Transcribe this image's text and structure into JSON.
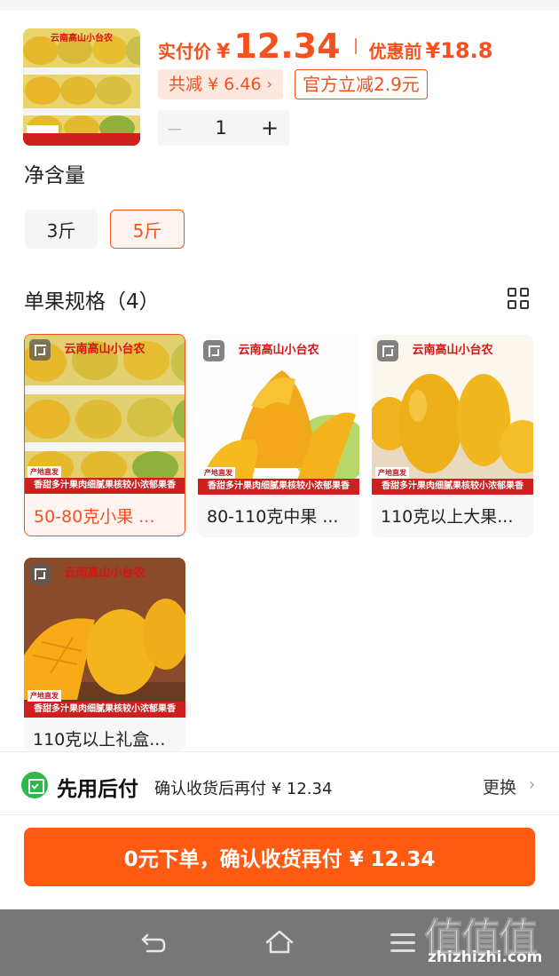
{
  "product": {
    "price_label": "实付价",
    "price_currency": "¥",
    "price_value": "12.34",
    "price_before_label": "优惠前",
    "price_before": "¥18.8",
    "discount_total": "共减 ¥ 6.46",
    "official_discount": "官方立减2.9元",
    "quantity": "1",
    "minus_label": "－",
    "plus_label": "+"
  },
  "net_content": {
    "title": "净含量",
    "options": [
      {
        "label": "3斤",
        "selected": false
      },
      {
        "label": "5斤",
        "selected": true
      }
    ]
  },
  "spec": {
    "title": "单果规格（4）",
    "items": [
      {
        "label": "50-80克小果 ...",
        "selected": true,
        "image": "mango-box"
      },
      {
        "label": "80-110克中果 ...",
        "selected": false,
        "image": "mango-peeled"
      },
      {
        "label": "110克以上大果...",
        "selected": false,
        "image": "mango-whole"
      },
      {
        "label": "110克以上礼盒...",
        "selected": false,
        "image": "mango-cut"
      }
    ]
  },
  "image_banner": {
    "brand": "云南高山小台农",
    "tagline": "香甜多汁果肉细腻果核较小浓郁果香",
    "badge": "产地直发"
  },
  "pay_later": {
    "title": "先用后付",
    "description": "确认收货后再付 ¥ 12.34",
    "change_label": "更换"
  },
  "cta": {
    "label": "0元下单，确认收货再付 ¥ 12.34"
  },
  "watermark": {
    "logo": "值值值",
    "url": "zhizhizhi.com"
  },
  "colors": {
    "accent": "#f4511e",
    "cta": "#ff5a12",
    "pay_green": "#2eb84c",
    "banner_red": "#d01f1f"
  }
}
